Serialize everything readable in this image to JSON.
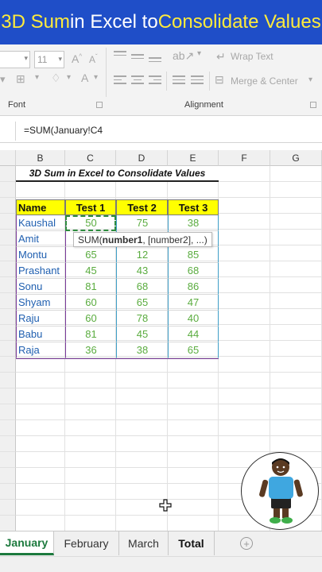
{
  "banner": {
    "part1": "3D Sum",
    "part2": " in Excel to ",
    "part3": "Consolidate Values"
  },
  "ribbon": {
    "font_size": "11",
    "wrap_text": "Wrap Text",
    "merge_center": "Merge & Center",
    "font_group_label": "Font",
    "alignment_group_label": "Alignment"
  },
  "formula_bar": {
    "formula": "=SUM(January!C4"
  },
  "columns": [
    "B",
    "C",
    "D",
    "E",
    "F",
    "G"
  ],
  "sheet": {
    "title": "3D Sum in Excel to Consolidate Values",
    "headers": [
      "Name",
      "Test 1",
      "Test 2",
      "Test 3"
    ],
    "rows": [
      {
        "name": "Kaushal",
        "t1": "50",
        "t2": "75",
        "t3": "38"
      },
      {
        "name": "Amit",
        "t1": "",
        "t2": "",
        "t3": ""
      },
      {
        "name": "Montu",
        "t1": "65",
        "t2": "12",
        "t3": "85"
      },
      {
        "name": "Prashant",
        "t1": "45",
        "t2": "43",
        "t3": "68"
      },
      {
        "name": "Sonu",
        "t1": "81",
        "t2": "68",
        "t3": "86"
      },
      {
        "name": "Shyam",
        "t1": "60",
        "t2": "65",
        "t3": "47"
      },
      {
        "name": "Raju",
        "t1": "60",
        "t2": "78",
        "t3": "40"
      },
      {
        "name": "Babu",
        "t1": "81",
        "t2": "45",
        "t3": "44"
      },
      {
        "name": "Raja",
        "t1": "36",
        "t2": "38",
        "t3": "65"
      }
    ]
  },
  "tooltip": {
    "fn": "SUM(",
    "arg1": "number1",
    "rest": ", [number2], ...)"
  },
  "tabs": [
    "January",
    "February",
    "March",
    "Total"
  ],
  "active_tab": "January",
  "colors": {
    "banner_bg": "#1f4ec8",
    "banner_highlight": "#ffeb3b",
    "header_fill": "#ffff00",
    "name_text": "#1f5fb0",
    "value_text": "#5aac3f",
    "active_tab": "#1d7a3e"
  }
}
